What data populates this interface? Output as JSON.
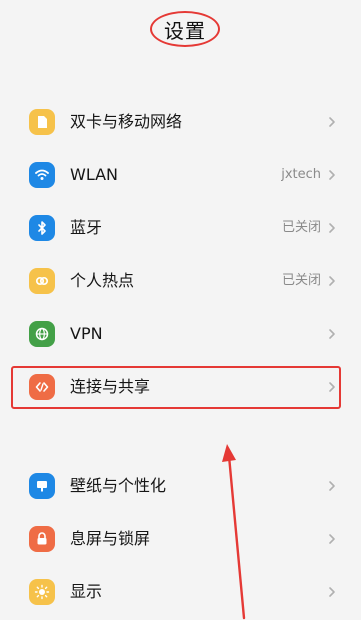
{
  "page": {
    "title": "设置"
  },
  "settings": {
    "items": [
      {
        "label": "双卡与移动网络",
        "value": "",
        "icon": "sim-card-icon",
        "color": "#f6c24a"
      },
      {
        "label": "WLAN",
        "value": "jxtech",
        "icon": "wifi-icon",
        "color": "#1e88e5"
      },
      {
        "label": "蓝牙",
        "value": "已关闭",
        "icon": "bluetooth-icon",
        "color": "#1e88e5"
      },
      {
        "label": "个人热点",
        "value": "已关闭",
        "icon": "hotspot-icon",
        "color": "#f6c24a"
      },
      {
        "label": "VPN",
        "value": "",
        "icon": "vpn-globe-icon",
        "color": "#43a047"
      },
      {
        "label": "连接与共享",
        "value": "",
        "icon": "connection-sharing-icon",
        "color": "#ef6c45"
      },
      {
        "label": "壁纸与个性化",
        "value": "",
        "icon": "wallpaper-icon",
        "color": "#1e88e5"
      },
      {
        "label": "息屏与锁屏",
        "value": "",
        "icon": "lock-icon",
        "color": "#ef6c45"
      },
      {
        "label": "显示",
        "value": "",
        "icon": "display-icon",
        "color": "#f6c24a"
      }
    ]
  },
  "annotations": {
    "highlight_color": "#e53935",
    "arrow_color": "#e53935"
  }
}
